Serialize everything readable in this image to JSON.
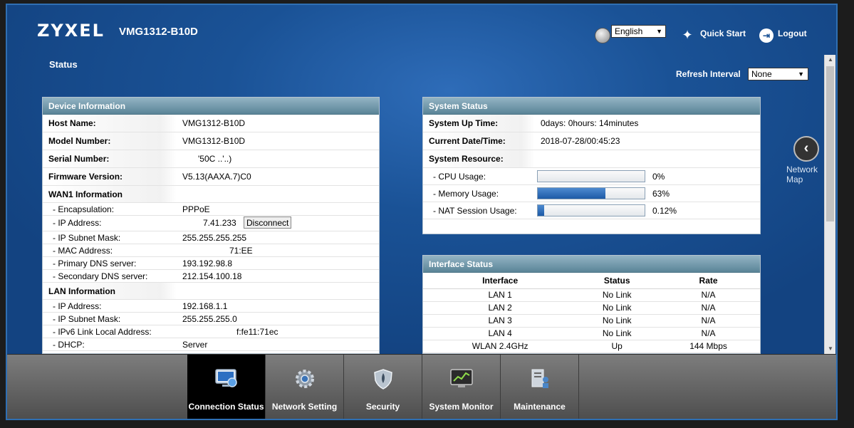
{
  "header": {
    "brand": "ZYXEL",
    "model": "VMG1312-B10D",
    "language": "English",
    "quick_start": "Quick Start",
    "logout": "Logout"
  },
  "page": {
    "title": "Status",
    "refresh_label": "Refresh Interval",
    "refresh_value": "None",
    "network_map": "Network Map"
  },
  "device_info": {
    "title": "Device Information",
    "rows": [
      {
        "label": "Host Name:",
        "value": "VMG1312-B10D"
      },
      {
        "label": "Model Number:",
        "value": "VMG1312-B10D"
      },
      {
        "label": "Serial Number:",
        "value": "'50C ..'..)"
      },
      {
        "label": "Firmware Version:",
        "value": "V5.13(AAXA.7)C0"
      }
    ],
    "wan_title": "WAN1 Information",
    "wan_rows": [
      {
        "label": "- Encapsulation:",
        "value": "PPPoE"
      },
      {
        "label": "- IP Address:",
        "value": "7.41.233"
      },
      {
        "label": "- IP Subnet Mask:",
        "value": "255.255.255.255"
      },
      {
        "label": "- MAC Address:",
        "value": "71:EE"
      },
      {
        "label": "- Primary DNS server:",
        "value": "193.192.98.8"
      },
      {
        "label": "- Secondary DNS server:",
        "value": "212.154.100.18"
      }
    ],
    "disconnect_label": "Disconnect",
    "lan_title": "LAN Information",
    "lan_rows": [
      {
        "label": "- IP Address:",
        "value": "192.168.1.1"
      },
      {
        "label": "- IP Subnet Mask:",
        "value": "255.255.255.0"
      },
      {
        "label": "- IPv6 Link Local Address:",
        "value": "f:fe11:71ec"
      },
      {
        "label": "- DHCP:",
        "value": "Server"
      }
    ]
  },
  "system_status": {
    "title": "System Status",
    "rows": [
      {
        "label": "System Up Time:",
        "value": "0days: 0hours: 14minutes"
      },
      {
        "label": "Current Date/Time:",
        "value": "2018-07-28/00:45:23"
      }
    ],
    "resource_title": "System Resource:",
    "resources": [
      {
        "label": "- CPU Usage:",
        "value": "0%",
        "fraction": 0
      },
      {
        "label": "- Memory Usage:",
        "value": "63%",
        "fraction": 0.63
      },
      {
        "label": "- NAT Session Usage:",
        "value": "0.12%",
        "fraction": 0.06
      }
    ]
  },
  "interface_status": {
    "title": "Interface Status",
    "columns": [
      "Interface",
      "Status",
      "Rate"
    ],
    "rows": [
      [
        "LAN 1",
        "No Link",
        "N/A"
      ],
      [
        "LAN 2",
        "No Link",
        "N/A"
      ],
      [
        "LAN 3",
        "No Link",
        "N/A"
      ],
      [
        "LAN 4",
        "No Link",
        "N/A"
      ],
      [
        "WLAN 2.4GHz",
        "Up",
        "144 Mbps"
      ]
    ]
  },
  "bottom_nav": [
    {
      "label": "Connection Status",
      "icon": "monitor-icon",
      "active": true
    },
    {
      "label": "Network Setting",
      "icon": "gear-icon",
      "active": false
    },
    {
      "label": "Security",
      "icon": "shield-icon",
      "active": false
    },
    {
      "label": "System Monitor",
      "icon": "chart-monitor-icon",
      "active": false
    },
    {
      "label": "Maintenance",
      "icon": "maintenance-icon",
      "active": false
    }
  ]
}
